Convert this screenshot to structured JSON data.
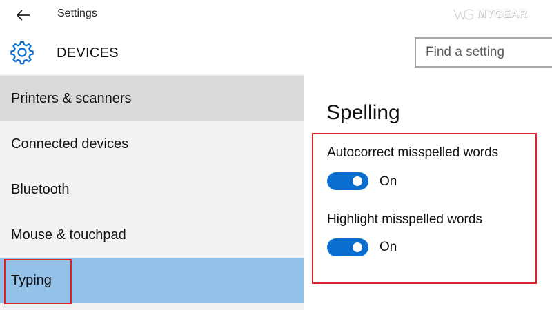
{
  "window": {
    "title": "Settings",
    "brand": "MYGEAR"
  },
  "header": {
    "section_title": "DEVICES",
    "search_placeholder": "Find a setting"
  },
  "sidebar": {
    "items": [
      {
        "label": "Printers & scanners",
        "state": "hover"
      },
      {
        "label": "Connected devices",
        "state": "normal"
      },
      {
        "label": "Bluetooth",
        "state": "normal"
      },
      {
        "label": "Mouse & touchpad",
        "state": "normal"
      },
      {
        "label": "Typing",
        "state": "selected"
      }
    ]
  },
  "content": {
    "group_title": "Spelling",
    "settings": [
      {
        "label": "Autocorrect misspelled words",
        "toggle_state": "On"
      },
      {
        "label": "Highlight misspelled words",
        "toggle_state": "On"
      }
    ]
  },
  "colors": {
    "accent": "#0a6ed1",
    "selected_bg": "#94c1e8",
    "annotation_red": "#d9242b",
    "sidebar_bg": "#f2f2f2"
  }
}
